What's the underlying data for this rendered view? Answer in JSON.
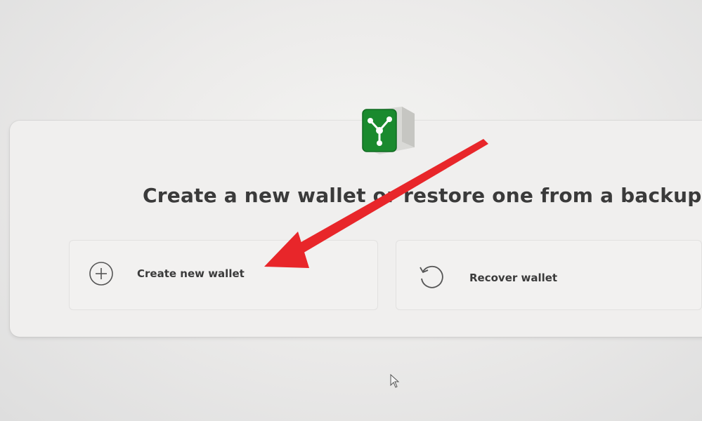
{
  "heading": "Create a new wallet or restore one from a backup",
  "options": [
    {
      "label": "Create new wallet",
      "icon": "plus-circle-icon"
    },
    {
      "label": "Recover wallet",
      "icon": "restore-icon"
    }
  ],
  "logo": {
    "icon": "wallet-logo-icon",
    "color": "#1a8a2e"
  },
  "annotation": {
    "icon": "red-arrow-icon",
    "color": "#e8262a"
  },
  "cursor": {
    "icon": "mouse-pointer-icon"
  }
}
